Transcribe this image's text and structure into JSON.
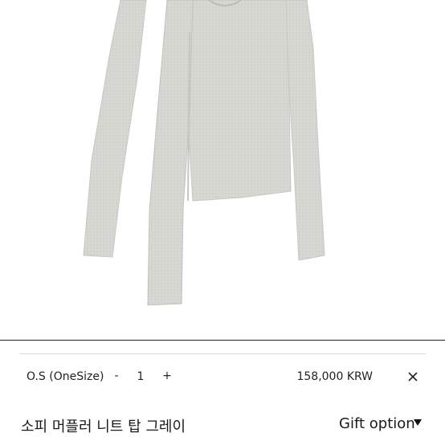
{
  "product": {
    "name": "소피 머플러 니트 탑 그레이",
    "image_color": "#d9d9d6"
  },
  "option": {
    "size_label": "O.S (OneSize)",
    "minus": "-",
    "quantity": "1",
    "plus": "+",
    "price": "158,000 KRW",
    "remove_icon": "close-icon"
  },
  "gift": {
    "label": "Gift option",
    "caret_icon": "caret-down-icon"
  }
}
